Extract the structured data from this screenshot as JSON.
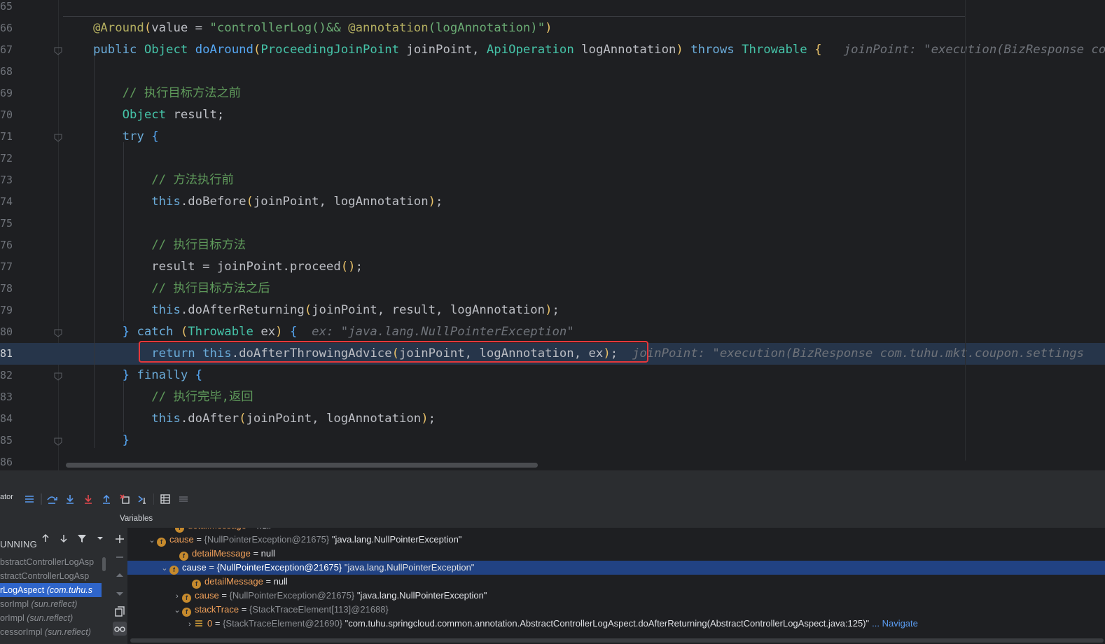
{
  "editor": {
    "lines": [
      {
        "num": "65",
        "segments": []
      },
      {
        "num": "66",
        "segments": [
          {
            "t": "@Around",
            "c": "ann"
          },
          {
            "t": "(",
            "c": "par"
          },
          {
            "t": "value = ",
            "c": "var"
          },
          {
            "t": "\"controllerLog()&& ",
            "c": "str"
          },
          {
            "t": "@annotation",
            "c": "ann"
          },
          {
            "t": "(logAnnotation)\"",
            "c": "str"
          },
          {
            "t": ")",
            "c": "par"
          }
        ]
      },
      {
        "num": "67",
        "segments": [
          {
            "t": "public ",
            "c": "blue"
          },
          {
            "t": "Object ",
            "c": "typ"
          },
          {
            "t": "doAround",
            "c": "fn"
          },
          {
            "t": "(",
            "c": "par"
          },
          {
            "t": "ProceedingJoinPoint ",
            "c": "typ"
          },
          {
            "t": "joinPoint, ",
            "c": "var"
          },
          {
            "t": "ApiOperation ",
            "c": "typ"
          },
          {
            "t": "logAnnotation",
            "c": "var"
          },
          {
            "t": ") ",
            "c": "par"
          },
          {
            "t": "throws ",
            "c": "blue"
          },
          {
            "t": "Throwable ",
            "c": "typ"
          },
          {
            "t": "{   ",
            "c": "par"
          },
          {
            "t": "joinPoint: \"execution(BizResponse com.tuhu.mkt.coupon.settings",
            "c": "hint"
          }
        ]
      },
      {
        "num": "68",
        "segments": []
      },
      {
        "num": "69",
        "segments": [
          {
            "t": "    // 执行目标方法之前",
            "c": "cmcn"
          }
        ]
      },
      {
        "num": "70",
        "segments": [
          {
            "t": "    Object ",
            "c": "typ"
          },
          {
            "t": "result;",
            "c": "var"
          }
        ]
      },
      {
        "num": "71",
        "segments": [
          {
            "t": "    try ",
            "c": "blue"
          },
          {
            "t": "{",
            "c": "fn"
          }
        ]
      },
      {
        "num": "72",
        "segments": []
      },
      {
        "num": "73",
        "segments": [
          {
            "t": "        // 方法执行前",
            "c": "cmcn"
          }
        ]
      },
      {
        "num": "74",
        "segments": [
          {
            "t": "        this",
            "c": "blue"
          },
          {
            "t": ".",
            "c": "var"
          },
          {
            "t": "doBefore",
            "c": "var"
          },
          {
            "t": "(",
            "c": "par"
          },
          {
            "t": "joinPoint, logAnnotation",
            "c": "var"
          },
          {
            "t": ")",
            "c": "par"
          },
          {
            "t": ";",
            "c": "var"
          }
        ]
      },
      {
        "num": "75",
        "segments": []
      },
      {
        "num": "76",
        "segments": [
          {
            "t": "        // 执行目标方法",
            "c": "cmcn"
          }
        ]
      },
      {
        "num": "77",
        "segments": [
          {
            "t": "        result = joinPoint.proceed",
            "c": "var"
          },
          {
            "t": "()",
            "c": "par"
          },
          {
            "t": ";",
            "c": "var"
          }
        ]
      },
      {
        "num": "78",
        "segments": [
          {
            "t": "        // 执行目标方法之后",
            "c": "cmcn"
          }
        ]
      },
      {
        "num": "79",
        "segments": [
          {
            "t": "        this",
            "c": "blue"
          },
          {
            "t": ".doAfterReturning",
            "c": "var"
          },
          {
            "t": "(",
            "c": "par"
          },
          {
            "t": "joinPoint, result, logAnnotation",
            "c": "var"
          },
          {
            "t": ")",
            "c": "par"
          },
          {
            "t": ";",
            "c": "var"
          }
        ]
      },
      {
        "num": "80",
        "segments": [
          {
            "t": "    } ",
            "c": "fn"
          },
          {
            "t": "catch ",
            "c": "blue"
          },
          {
            "t": "(",
            "c": "par"
          },
          {
            "t": "Throwable ",
            "c": "typ"
          },
          {
            "t": "ex",
            "c": "var"
          },
          {
            "t": ") ",
            "c": "par"
          },
          {
            "t": "{  ",
            "c": "fn"
          },
          {
            "t": "ex: \"java.lang.NullPointerException\"",
            "c": "hint"
          }
        ]
      },
      {
        "num": "81",
        "current": true,
        "segments": [
          {
            "t": "        return ",
            "c": "blue"
          },
          {
            "t": "this",
            "c": "blue"
          },
          {
            "t": ".doAfterThrowingAdvice",
            "c": "var"
          },
          {
            "t": "(",
            "c": "par"
          },
          {
            "t": "joinPoint, logAnnotation, ex",
            "c": "var"
          },
          {
            "t": ")",
            "c": "par"
          },
          {
            "t": ";  ",
            "c": "var"
          },
          {
            "t": "joinPoint: \"execution(BizResponse com.tuhu.mkt.coupon.settings",
            "c": "hint"
          }
        ]
      },
      {
        "num": "82",
        "segments": [
          {
            "t": "    } ",
            "c": "fn"
          },
          {
            "t": "finally ",
            "c": "blue"
          },
          {
            "t": "{",
            "c": "fn"
          }
        ]
      },
      {
        "num": "83",
        "segments": [
          {
            "t": "        // 执行完毕,返回",
            "c": "cmcn"
          }
        ]
      },
      {
        "num": "84",
        "segments": [
          {
            "t": "        this",
            "c": "blue"
          },
          {
            "t": ".doAfter",
            "c": "var"
          },
          {
            "t": "(",
            "c": "par"
          },
          {
            "t": "joinPoint, logAnnotation",
            "c": "var"
          },
          {
            "t": ")",
            "c": "par"
          },
          {
            "t": ";",
            "c": "var"
          }
        ]
      },
      {
        "num": "85",
        "segments": [
          {
            "t": "    }",
            "c": "fn"
          }
        ]
      },
      {
        "num": "86",
        "segments": []
      }
    ]
  },
  "debug": {
    "toolbar_label": "ator",
    "variables_title": "Variables",
    "frames": {
      "status": "UNNING",
      "items": [
        {
          "text": "bstractControllerLogAsp",
          "italic": "",
          "selected": false
        },
        {
          "text": "stractControllerLogAsp",
          "italic": "",
          "selected": false
        },
        {
          "text": "rLogAspect ",
          "italic": "(com.tuhu.s",
          "selected": true
        },
        {
          "text": "sorImpl ",
          "italic": "(sun.reflect)",
          "selected": false
        },
        {
          "text": "orImpl ",
          "italic": "(sun.reflect)",
          "selected": false
        },
        {
          "text": "cessorImpl ",
          "italic": "(sun.reflect)",
          "selected": false
        }
      ]
    },
    "variables": [
      {
        "indent": 54,
        "chev": "",
        "icon": "f",
        "name": "detailMessage",
        "eq": " = ",
        "type": "",
        "value": "null",
        "nav": "",
        "selected": false,
        "clip": true
      },
      {
        "indent": 28,
        "chev": "⌄",
        "icon": "f",
        "name": "cause",
        "eq": " = ",
        "type": "{NullPointerException@21675} ",
        "value": "\"java.lang.NullPointerException\"",
        "nav": "",
        "selected": false
      },
      {
        "indent": 60,
        "chev": "",
        "icon": "f",
        "name": "detailMessage",
        "eq": " = ",
        "type": "",
        "value": "null",
        "nav": "",
        "selected": false
      },
      {
        "indent": 46,
        "chev": "⌄",
        "icon": "f",
        "name": "cause",
        "eq": " = ",
        "type": "{NullPointerException@21675} ",
        "value": "\"java.lang.NullPointerException\"",
        "nav": "",
        "selected": true
      },
      {
        "indent": 78,
        "chev": "",
        "icon": "f",
        "name": "detailMessage",
        "eq": " = ",
        "type": "",
        "value": "null",
        "nav": "",
        "selected": false
      },
      {
        "indent": 64,
        "chev": "›",
        "icon": "f",
        "name": "cause",
        "eq": " = ",
        "type": "{NullPointerException@21675} ",
        "value": "\"java.lang.NullPointerException\"",
        "nav": "",
        "selected": false
      },
      {
        "indent": 64,
        "chev": "⌄",
        "icon": "f",
        "name": "stackTrace",
        "eq": " = ",
        "type": "{StackTraceElement[113]@21688}",
        "value": "",
        "nav": "",
        "selected": false
      },
      {
        "indent": 82,
        "chev": "›",
        "icon": "list",
        "name": "0",
        "eq": " = ",
        "type": "{StackTraceElement@21690} ",
        "value": "\"com.tuhu.springcloud.common.annotation.AbstractControllerLogAspect.doAfterReturning(AbstractControllerLogAspect.java:125)\"",
        "nav": "... Navigate",
        "selected": false
      }
    ]
  }
}
